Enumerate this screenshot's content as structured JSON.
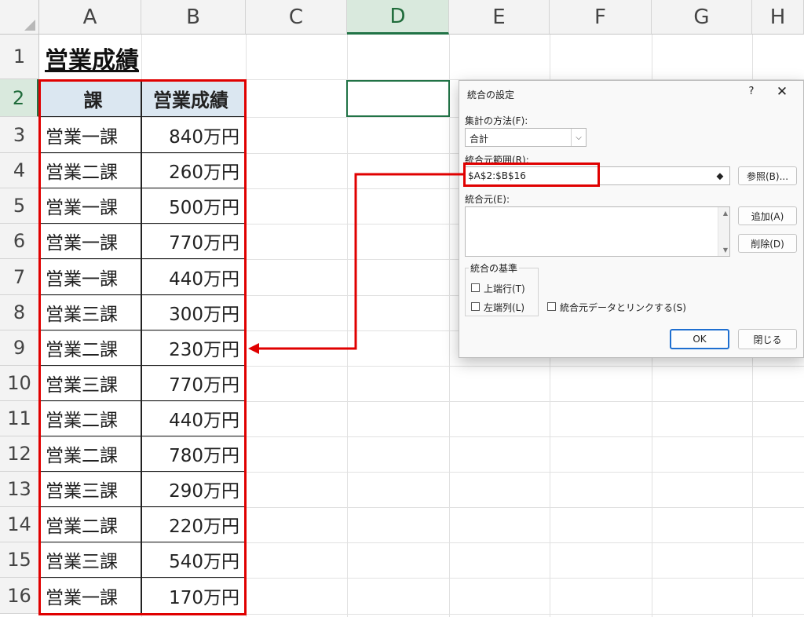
{
  "spreadsheet": {
    "columns": [
      "A",
      "B",
      "C",
      "D",
      "E",
      "F",
      "G",
      "H"
    ],
    "rows": [
      "1",
      "2",
      "3",
      "4",
      "5",
      "6",
      "7",
      "8",
      "9",
      "10",
      "11",
      "12",
      "13",
      "14",
      "15",
      "16"
    ],
    "title": "営業成績",
    "table_headers": [
      "課",
      "営業成績"
    ],
    "table_rows": [
      [
        "営業一課",
        "840万円"
      ],
      [
        "営業二課",
        "260万円"
      ],
      [
        "営業一課",
        "500万円"
      ],
      [
        "営業一課",
        "770万円"
      ],
      [
        "営業一課",
        "440万円"
      ],
      [
        "営業三課",
        "300万円"
      ],
      [
        "営業二課",
        "230万円"
      ],
      [
        "営業三課",
        "770万円"
      ],
      [
        "営業二課",
        "440万円"
      ],
      [
        "営業二課",
        "780万円"
      ],
      [
        "営業三課",
        "290万円"
      ],
      [
        "営業二課",
        "220万円"
      ],
      [
        "営業三課",
        "540万円"
      ],
      [
        "営業一課",
        "170万円"
      ]
    ],
    "selected_column": "D",
    "selected_row": "2"
  },
  "dialog": {
    "title": "統合の設定",
    "help": "?",
    "close": "✕",
    "function_label": "集計の方法(F):",
    "function_value": "合計",
    "reference_label": "統合元範囲(R):",
    "reference_value": "$A$2:$B$16",
    "browse_button": "参照(B)...",
    "all_references_label": "統合元(E):",
    "add_button": "追加(A)",
    "delete_button": "削除(D)",
    "labels_group_title": "統合の基準",
    "top_row_label": "上端行(T)",
    "left_column_label": "左端列(L)",
    "link_label": "統合元データとリンクする(S)",
    "ok_button": "OK",
    "close_button": "閉じる"
  },
  "colors": {
    "highlight_red": "#e00000",
    "selection_green": "#217346",
    "header_fill": "#dbe7f1"
  }
}
